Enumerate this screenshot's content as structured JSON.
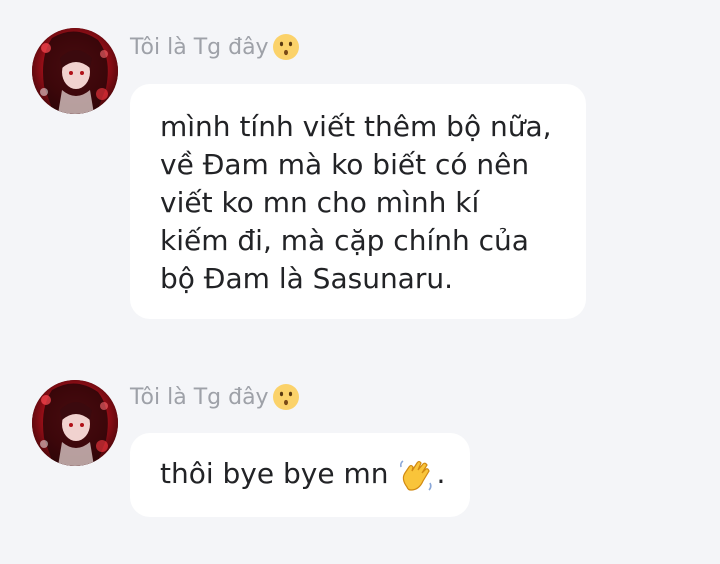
{
  "messages": [
    {
      "sender": "Tôi là Tg đây",
      "sender_emoji": "kissing-face-emoji",
      "avatar": "anime-avatar-red",
      "text_lines": [
        "mình tính viết thêm bộ nữa,",
        "về Đam mà ko biết có nên",
        "viết ko mn cho mình kí",
        "kiếm đi, mà cặp chính của",
        "bộ Đam là Sasunaru."
      ]
    },
    {
      "sender": "Tôi là Tg đây",
      "sender_emoji": "kissing-face-emoji",
      "avatar": "anime-avatar-red",
      "text": "thôi bye bye mn",
      "emoji": "waving-hand-emoji",
      "trailing": "."
    }
  ],
  "colors": {
    "background": "#f4f5f8",
    "bubble": "#ffffff",
    "sender_text": "#9ea1a8",
    "message_text": "#222326",
    "avatar_red": "#c0141c"
  }
}
